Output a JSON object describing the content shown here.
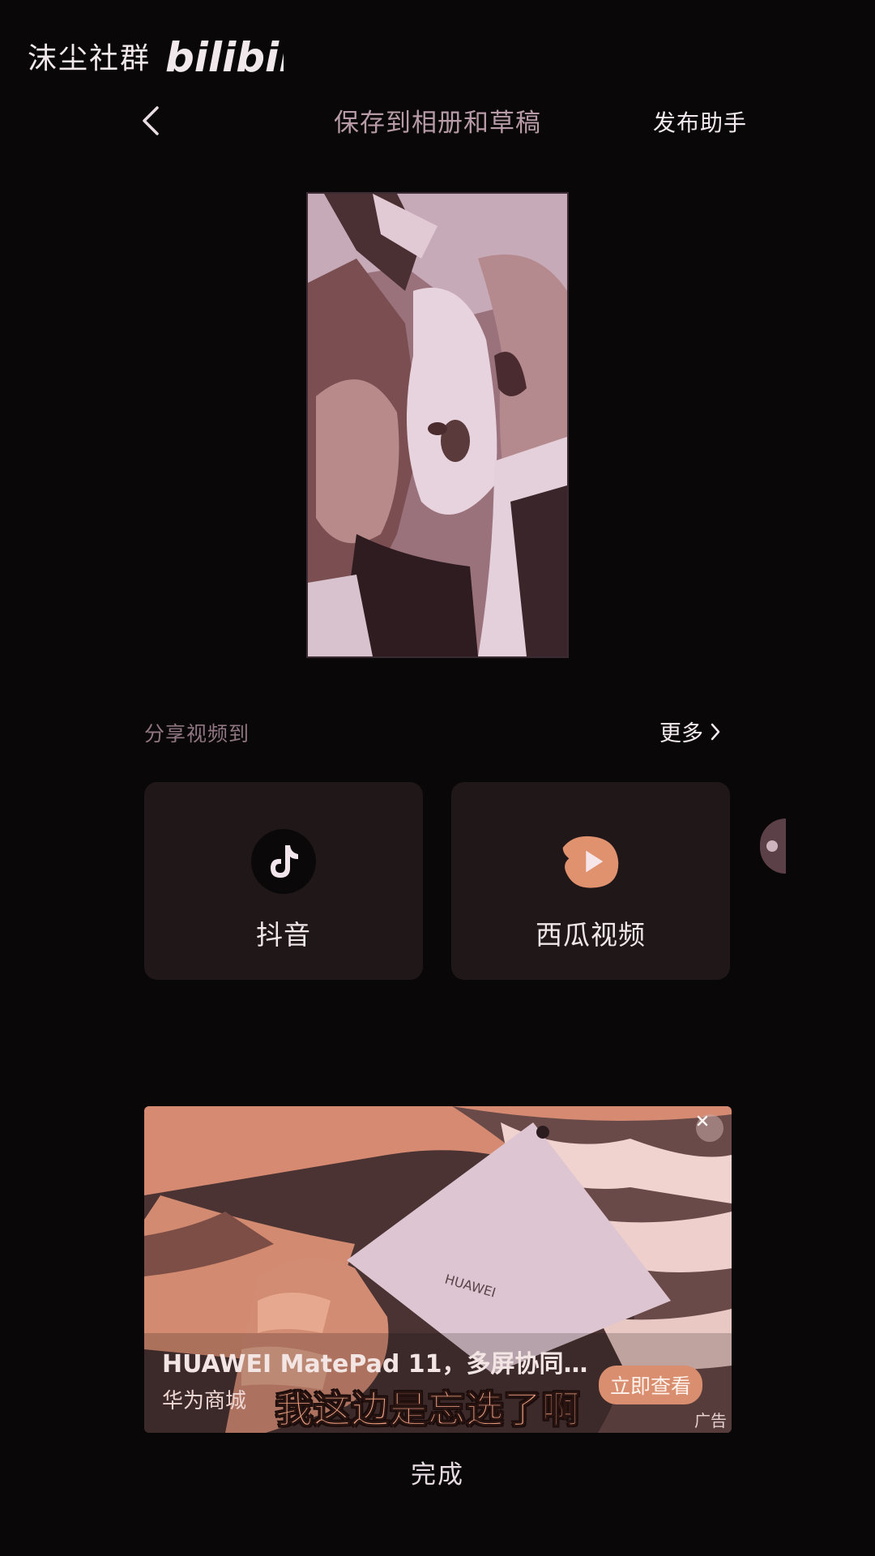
{
  "watermark": {
    "text": "沫尘社群",
    "logo_text": "bilibili"
  },
  "header": {
    "back_icon": "chevron-left-icon",
    "title": "保存到相册和草稿",
    "assistant_label": "发布助手"
  },
  "share": {
    "label": "分享视频到",
    "more_label": "更多",
    "platforms": [
      {
        "name": "抖音",
        "icon": "douyin-icon"
      },
      {
        "name": "西瓜视频",
        "icon": "xigua-icon"
      }
    ]
  },
  "ad": {
    "title": "HUAWEI MatePad 11，多屏协同…",
    "brand": "华为商城",
    "cta": "立即查看",
    "tag": "广告",
    "product_text": "HUAWEI",
    "subtitle": "我这边是忘选了啊"
  },
  "footer": {
    "done_label": "完成"
  },
  "colors": {
    "background": "#0a0708",
    "card": "#201719",
    "accent": "#d98f6f",
    "muted_text": "#8f7680"
  }
}
